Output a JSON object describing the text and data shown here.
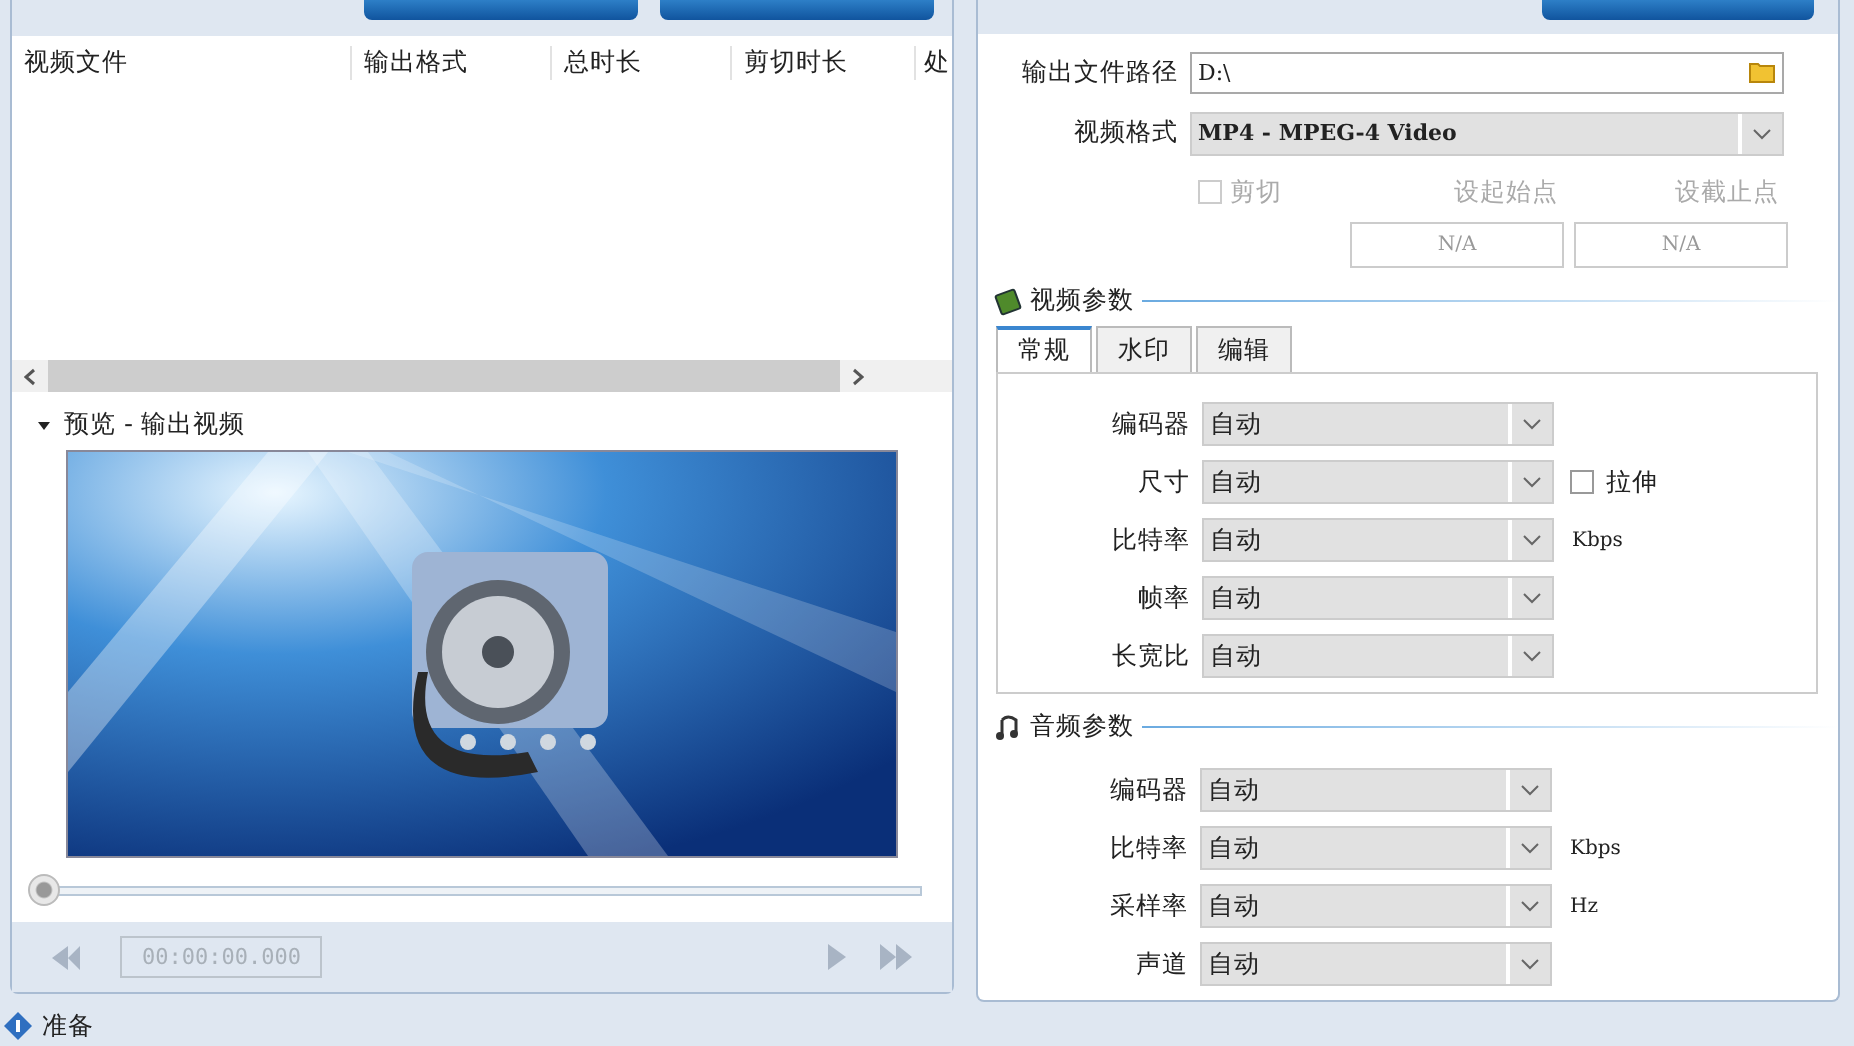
{
  "source": {
    "columns": [
      "视频文件",
      "输出格式",
      "总时长",
      "剪切时长",
      "处"
    ]
  },
  "preview": {
    "title": "预览 - 输出视频",
    "expanded": true,
    "slider": {
      "level": 0
    },
    "time": "00:00:00.000"
  },
  "output": {
    "path_label": "输出文件路径",
    "path": "D:\\",
    "format_label": "视频格式",
    "format": "MP4 - MPEG-4 Video",
    "cut": {
      "label": "剪切",
      "checked": false,
      "disabled": true
    },
    "start": {
      "label": "设起始点",
      "value": "N/A"
    },
    "end": {
      "label": "设截止点",
      "value": "N/A"
    },
    "video": {
      "title": "视频参数",
      "tabs": [
        {
          "label": "常规",
          "selected": true
        },
        {
          "label": "水印",
          "selected": false
        },
        {
          "label": "编辑",
          "selected": false
        }
      ],
      "fields": [
        {
          "label": "编码器",
          "value": "自动"
        },
        {
          "label": "尺寸",
          "value": "自动",
          "checkbox": {
            "label": "拉伸",
            "checked": false
          }
        },
        {
          "label": "比特率",
          "value": "自动",
          "unit": "Kbps"
        },
        {
          "label": "帧率",
          "value": "自动"
        },
        {
          "label": "长宽比",
          "value": "自动"
        }
      ]
    },
    "audio": {
      "title": "音频参数",
      "fields": [
        {
          "label": "编码器",
          "value": "自动"
        },
        {
          "label": "比特率",
          "value": "自动",
          "unit": "Kbps"
        },
        {
          "label": "采样率",
          "value": "自动",
          "unit": "Hz"
        },
        {
          "label": "声道",
          "value": "自动"
        }
      ]
    }
  },
  "status_bar": "准备"
}
